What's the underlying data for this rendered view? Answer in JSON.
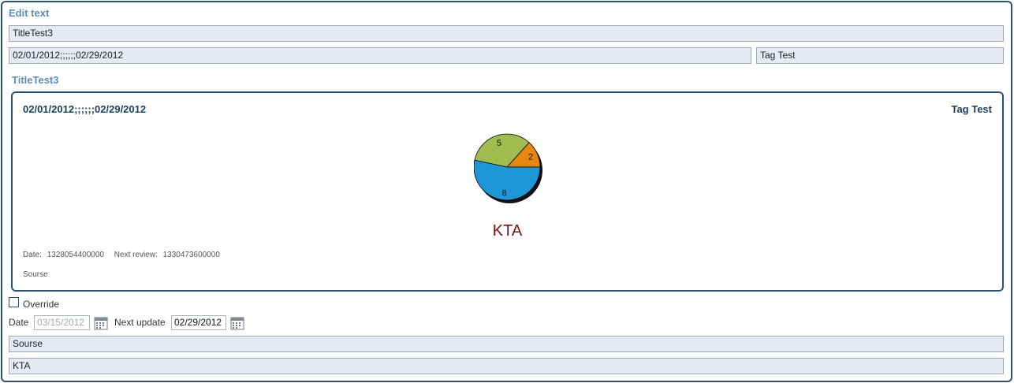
{
  "form": {
    "heading": "Edit text",
    "title_value": "TitleTest3",
    "period_value": "02/01/2012;;;;;;02/29/2012",
    "tag_value": "Tag Test"
  },
  "preview": {
    "heading": "TitleTest3",
    "period": "02/01/2012;;;;;;02/29/2012",
    "tag": "Tag Test",
    "chart_title": "KTA",
    "date_label": "Date:",
    "date_value": "1328054400000",
    "next_review_label": "Next review:",
    "next_review_value": "1330473600000",
    "source": "Sourse"
  },
  "chart_data": {
    "type": "pie",
    "title": "KTA",
    "slices": [
      {
        "label": "2",
        "value": 2,
        "color": "#e8870f"
      },
      {
        "label": "5",
        "value": 5,
        "color": "#a2bb4f"
      },
      {
        "label": "8",
        "value": 8,
        "color": "#1d97d8"
      }
    ]
  },
  "controls": {
    "override_label": "Override",
    "override_checked": false,
    "date_label": "Date",
    "date_value": "03/15/2012",
    "next_update_label": "Next update",
    "next_update_value": "02/29/2012",
    "source_value": "Sourse",
    "kta_value": "KTA"
  },
  "icons": {
    "calendar": "calendar-icon",
    "checkbox": "checkbox-icon"
  }
}
